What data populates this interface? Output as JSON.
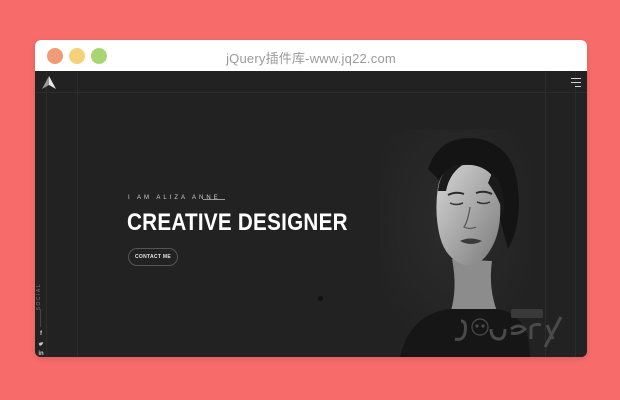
{
  "window": {
    "title": "jQuery插件库-www.jq22.com"
  },
  "hero": {
    "intro": "I AM ALIZA ANNE",
    "headline": "CREATIVE DESIGNER",
    "cta_label": "CONTACT ME"
  },
  "social": {
    "label": "SOCIAL",
    "icons": [
      "facebook-icon",
      "twitter-icon",
      "linkedin-icon"
    ]
  },
  "colors": {
    "page_bg": "#f86b6b",
    "site_bg": "#222222",
    "text": "#ffffff"
  }
}
